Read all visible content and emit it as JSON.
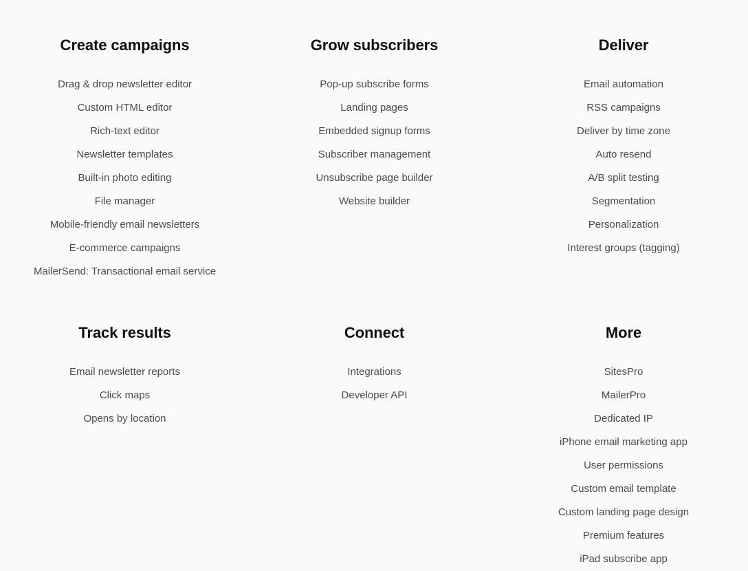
{
  "page": {
    "background_color": "#fafafa",
    "heading_color": "#12100e",
    "link_color": "#4a4a4a"
  },
  "columns": [
    {
      "heading": "Create campaigns",
      "links": [
        "Drag & drop newsletter editor",
        "Custom HTML editor",
        "Rich-text editor",
        "Newsletter templates",
        "Built-in photo editing",
        "File manager",
        "Mobile-friendly email newsletters",
        "E-commerce campaigns",
        "MailerSend: Transactional email service"
      ]
    },
    {
      "heading": "Grow subscribers",
      "links": [
        "Pop-up subscribe forms",
        "Landing pages",
        "Embedded signup forms",
        "Subscriber management",
        "Unsubscribe page builder",
        "Website builder"
      ]
    },
    {
      "heading": "Deliver",
      "links": [
        "Email automation",
        "RSS campaigns",
        "Deliver by time zone",
        "Auto resend",
        "A/B split testing",
        "Segmentation",
        "Personalization",
        "Interest groups (tagging)"
      ]
    },
    {
      "heading": "Track results",
      "links": [
        "Email newsletter reports",
        "Click maps",
        "Opens by location"
      ]
    },
    {
      "heading": "Connect",
      "links": [
        "Integrations",
        "Developer API"
      ]
    },
    {
      "heading": "More",
      "links": [
        "SitesPro",
        "MailerPro",
        "Dedicated IP",
        "iPhone email marketing app",
        "User permissions",
        "Custom email template",
        "Custom landing page design",
        "Premium features",
        "iPad subscribe app"
      ]
    }
  ]
}
